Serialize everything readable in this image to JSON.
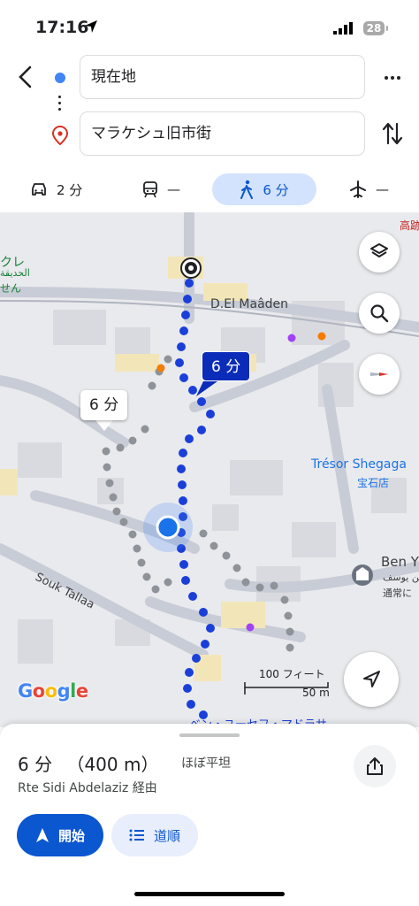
{
  "status_bar": {
    "time": "17:16",
    "battery": "28"
  },
  "route_inputs": {
    "origin": "現在地",
    "destination": "マラケシュ旧市街"
  },
  "modes": [
    {
      "name": "drive",
      "label": "2 分",
      "selected": false
    },
    {
      "name": "transit",
      "label": "—",
      "selected": false
    },
    {
      "name": "walk",
      "label": "6 分",
      "selected": true
    },
    {
      "name": "flight",
      "label": "—",
      "selected": false
    }
  ],
  "map": {
    "route_badge_primary": "6 分",
    "route_badge_alt": "6 分",
    "labels": {
      "street": "D.El Maâden",
      "poi_tresor": "Trésor Shegaga",
      "poi_tresor_jp": "宝石店",
      "souk": "Souk Tallaa",
      "poi_beny": "Ben Y",
      "poi_beny_ar": "بن يوسف",
      "poi_beny_hours": "通常に",
      "poi_kure": "クレ",
      "poi_kure_ar": "الحديقة",
      "poi_kure_sub": "せん",
      "poi_kodai": "高跡",
      "bottom_street": "ベン・ユーセフ・マドラサ"
    },
    "scale_ft": "100 フィート",
    "scale_m": "50 m",
    "google_logo": "Google"
  },
  "summary": {
    "duration": "6 分",
    "distance": "（400 m）",
    "terrain": "ほぼ平坦",
    "via": "Rte Sidi Abdelaziz 経由"
  },
  "actions": {
    "start": "開始",
    "steps": "道順"
  },
  "colors": {
    "accent": "#0b57d0",
    "route": "#1a3fd9",
    "alt_route": "#8e9399"
  }
}
